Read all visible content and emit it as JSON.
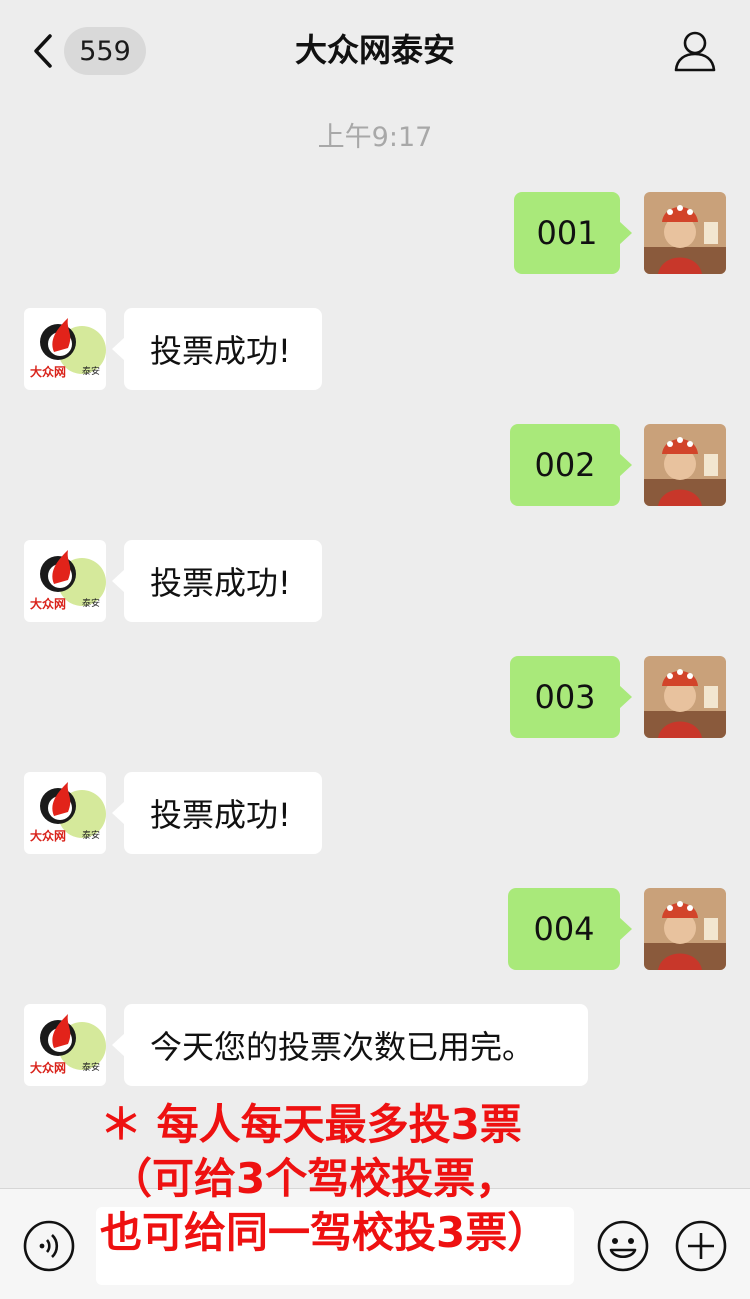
{
  "header": {
    "back_count": "559",
    "title": "大众网泰安"
  },
  "timestamp": "上午9:17",
  "messages": [
    {
      "from": "me",
      "text": "001"
    },
    {
      "from": "official",
      "text": "投票成功!"
    },
    {
      "from": "me",
      "text": "002"
    },
    {
      "from": "official",
      "text": "投票成功!"
    },
    {
      "from": "me",
      "text": "003"
    },
    {
      "from": "official",
      "text": "投票成功!"
    },
    {
      "from": "me",
      "text": "004"
    },
    {
      "from": "official",
      "text": "今天您的投票次数已用完。"
    }
  ],
  "official_logo_text": "大众网",
  "official_logo_sub": "泰安",
  "notice": {
    "line1": "＊ 每人每天最多投3票",
    "line2": "（可给3个驾校投票，",
    "line3": "也可给同一驾校投3票）"
  },
  "colors": {
    "outgoing_bubble": "#a9e97a",
    "incoming_bubble": "#ffffff",
    "background": "#ededed",
    "notice": "#ee1111"
  },
  "icons": [
    "chevron-left-icon",
    "person-icon",
    "voice-icon",
    "emoji-icon",
    "plus-icon"
  ]
}
